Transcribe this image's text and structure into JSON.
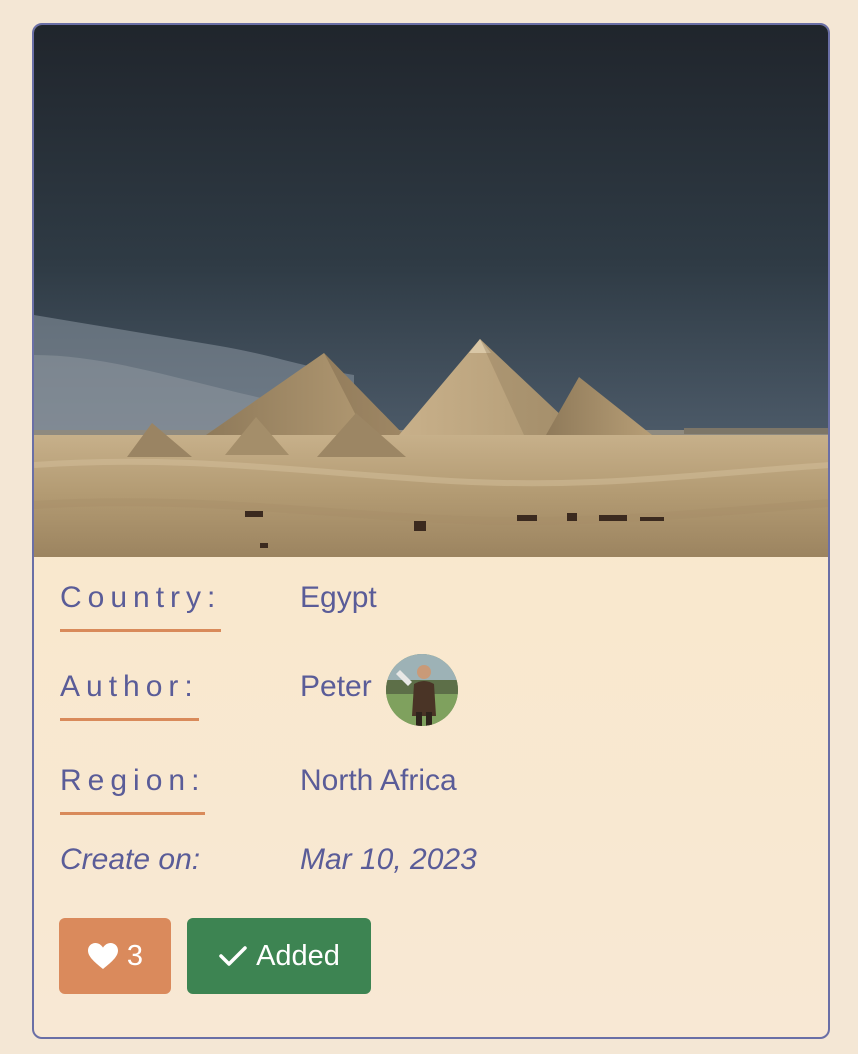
{
  "post": {
    "image_alt": "Pyramids of Giza in the desert under a dark sky",
    "fields": {
      "country_label": "Country:",
      "country_value": "Egypt",
      "author_label": "Author:",
      "author_value": "Peter",
      "region_label": "Region:",
      "region_value": "North Africa",
      "created_label": "Create on:",
      "created_value": "Mar 10, 2023"
    },
    "actions": {
      "like_count": "3",
      "added_label": "Added"
    }
  },
  "colors": {
    "accent_label": "#5a5c98",
    "underline": "#d98a5a",
    "like_button": "#da8a5c",
    "added_button": "#3d8452",
    "card_border": "#6a6fa6"
  },
  "icons": {
    "like": "heart-icon",
    "added": "check-icon"
  }
}
